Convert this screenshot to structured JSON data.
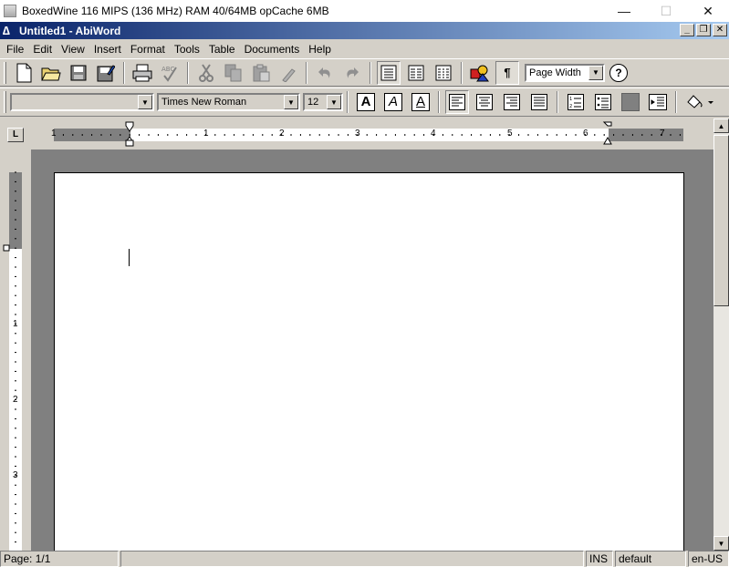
{
  "host_window": {
    "title": "BoxedWine 116 MIPS (136 MHz) RAM 40/64MB opCache 6MB",
    "controls": {
      "minimize": "—",
      "maximize": "☐",
      "close": "✕"
    }
  },
  "app_window": {
    "title": "Untitled1 - AbiWord",
    "controls": {
      "minimize": "_",
      "restore": "❐",
      "close": "✕"
    }
  },
  "menu": {
    "items": [
      "File",
      "Edit",
      "View",
      "Insert",
      "Format",
      "Tools",
      "Table",
      "Documents",
      "Help"
    ]
  },
  "toolbar_standard": {
    "zoom": "Page Width",
    "help": "?"
  },
  "toolbar_format": {
    "style": "",
    "font": "Times New Roman",
    "size": "12",
    "bold": "A",
    "italic": "A",
    "underline": "A"
  },
  "ruler": {
    "tab_selector": "L",
    "h_numbers": [
      "1",
      "1",
      "2",
      "3",
      "4",
      "5",
      "6",
      "7"
    ],
    "v_numbers": [
      "1",
      "2",
      "3"
    ]
  },
  "status": {
    "page": "Page: 1/1",
    "mode": "INS",
    "style": "default",
    "lang": "en-US"
  },
  "colors": {
    "title_gradient_start": "#0a246a",
    "title_gradient_end": "#a6caf0",
    "chrome": "#d4d0c8",
    "desk": "#808080"
  }
}
